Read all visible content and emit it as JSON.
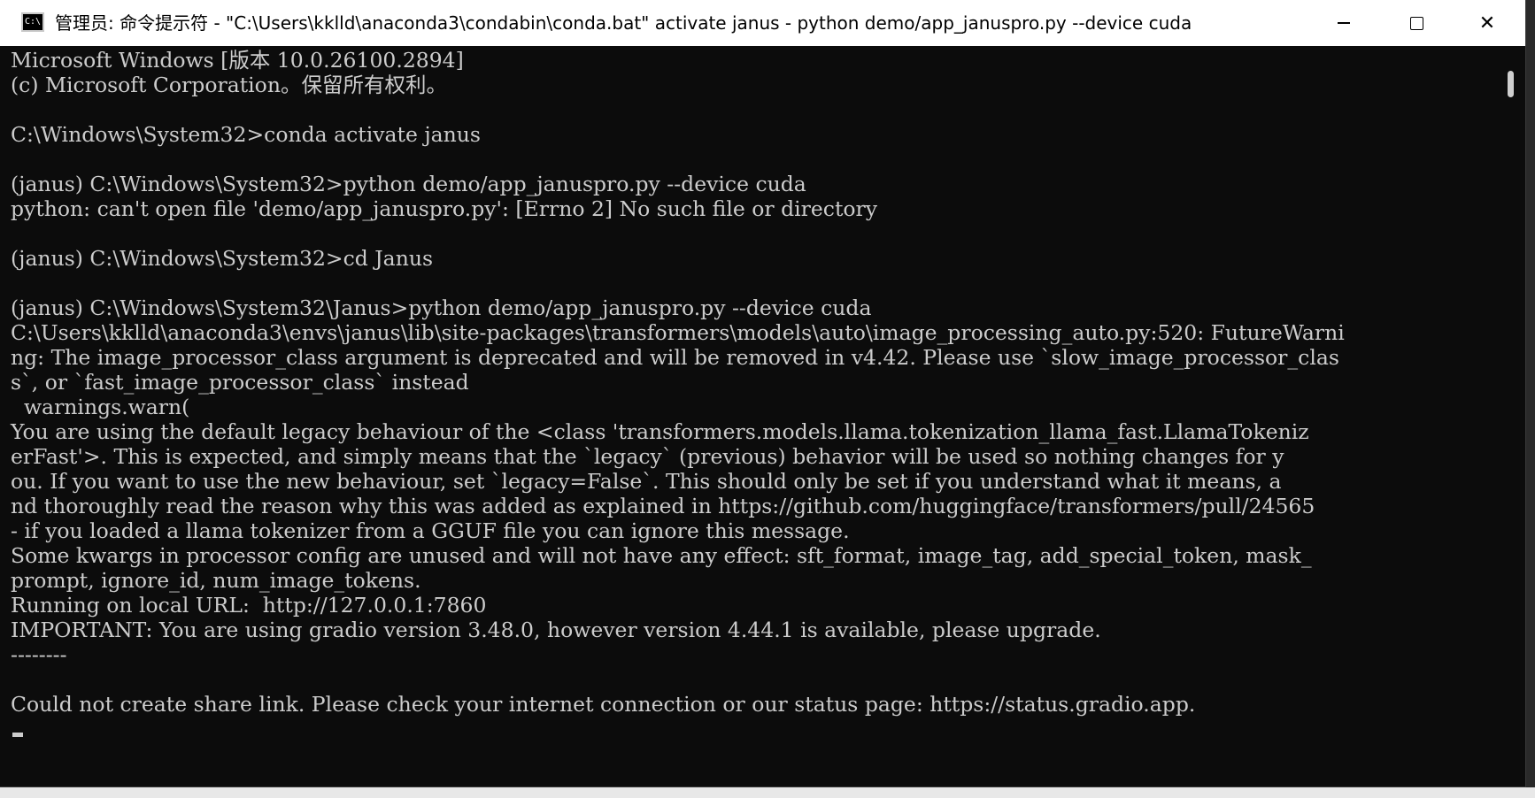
{
  "window": {
    "icon_label": "C:\\",
    "title": "管理员: 命令提示符 - \"C:\\Users\\kklld\\anaconda3\\condabin\\conda.bat\"  activate janus - python  demo/app_januspro.py --device cuda",
    "minimize_label": "",
    "maximize_label": "",
    "close_label": "✕"
  },
  "console": {
    "lines": [
      "Microsoft Windows [版本 10.0.26100.2894]",
      "(c) Microsoft Corporation。保留所有权利。",
      "",
      "C:\\Windows\\System32>conda activate janus",
      "",
      "(janus) C:\\Windows\\System32>python demo/app_januspro.py --device cuda",
      "python: can't open file 'demo/app_januspro.py': [Errno 2] No such file or directory",
      "",
      "(janus) C:\\Windows\\System32>cd Janus",
      "",
      "(janus) C:\\Windows\\System32\\Janus>python demo/app_januspro.py --device cuda",
      "C:\\Users\\kklld\\anaconda3\\envs\\janus\\lib\\site-packages\\transformers\\models\\auto\\image_processing_auto.py:520: FutureWarni",
      "ng: The image_processor_class argument is deprecated and will be removed in v4.42. Please use `slow_image_processor_clas",
      "s`, or `fast_image_processor_class` instead",
      "  warnings.warn(",
      "You are using the default legacy behaviour of the <class 'transformers.models.llama.tokenization_llama_fast.LlamaTokeniz",
      "erFast'>. This is expected, and simply means that the `legacy` (previous) behavior will be used so nothing changes for y",
      "ou. If you want to use the new behaviour, set `legacy=False`. This should only be set if you understand what it means, a",
      "nd thoroughly read the reason why this was added as explained in https://github.com/huggingface/transformers/pull/24565",
      "- if you loaded a llama tokenizer from a GGUF file you can ignore this message.",
      "Some kwargs in processor config are unused and will not have any effect: sft_format, image_tag, add_special_token, mask_",
      "prompt, ignore_id, num_image_tokens.",
      "Running on local URL:  http://127.0.0.1:7860",
      "IMPORTANT: You are using gradio version 3.48.0, however version 4.44.1 is available, please upgrade.",
      "--------",
      "",
      "Could not create share link. Please check your internet connection or our status page: https://status.gradio.app."
    ]
  },
  "colors": {
    "console_bg": "#0c0c0c",
    "console_fg": "#cccccc",
    "titlebar_bg": "#ffffff"
  }
}
